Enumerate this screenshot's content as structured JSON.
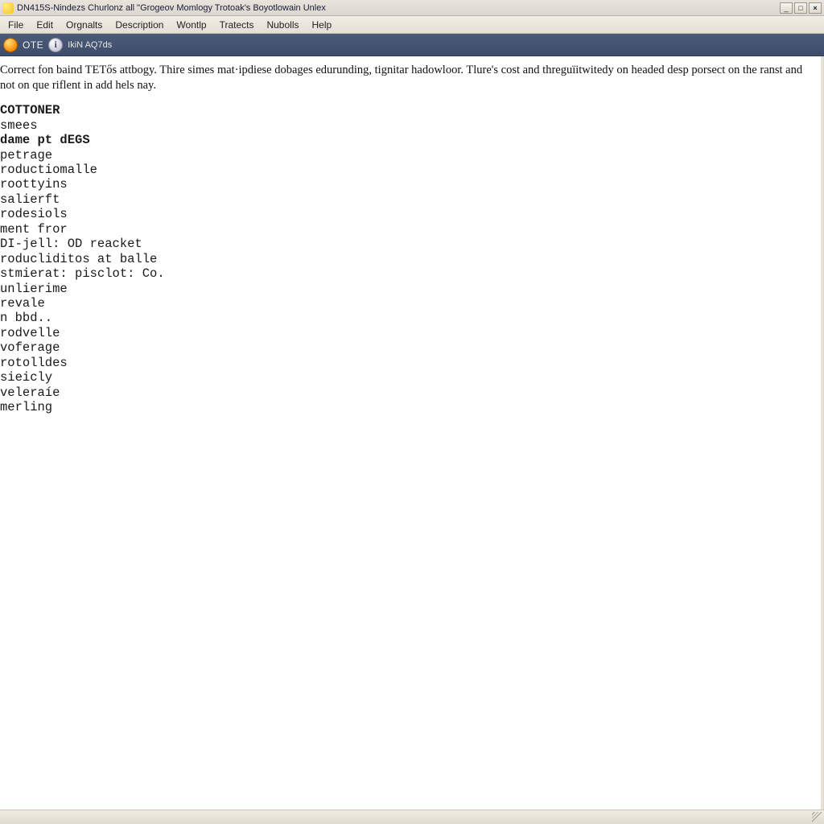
{
  "window": {
    "title": "DN415S-Nindezs Churlonz all \"Grogeov Momlogy Trotoak's Boyotlowain Unlex",
    "controls": {
      "minimize": "_",
      "maximize": "□",
      "close": "×"
    }
  },
  "menu": {
    "items": [
      "File",
      "Edit",
      "Orgnalts",
      "Description",
      "Wontlp",
      "Tratects",
      "Nubolls",
      "Help"
    ]
  },
  "infobar": {
    "ote": "OTE",
    "sub": "IkiN AQ7ds"
  },
  "content": {
    "intro": "Correct fon baind TETős attbogy. Thire simes mat·ipdiese dobages edurunding, tignitar hadowloor. Tlure's cost and threguïitwitedy on headed desp porsect on the ranst and not on que riflent in add hels nay.",
    "list": [
      {
        "text": "COTTONER",
        "bold": true
      },
      {
        "text": "smees",
        "bold": false
      },
      {
        "text": "dame pt dEGS",
        "bold": true
      },
      {
        "text": "petrage",
        "bold": false
      },
      {
        "text": "roductiomalle",
        "bold": false
      },
      {
        "text": "roottyins",
        "bold": false
      },
      {
        "text": "salierft",
        "bold": false
      },
      {
        "text": "rodesiols",
        "bold": false
      },
      {
        "text": "ment fror",
        "bold": false
      },
      {
        "text": "DI-jell: OD reacket",
        "bold": false
      },
      {
        "text": "roducliditos at balle",
        "bold": false
      },
      {
        "text": "stmierat: pisclot: Co.",
        "bold": false
      },
      {
        "text": "unlierime",
        "bold": false
      },
      {
        "text": "revale",
        "bold": false
      },
      {
        "text": "n bbd..",
        "bold": false
      },
      {
        "text": "rodvelle",
        "bold": false
      },
      {
        "text": "voferage",
        "bold": false
      },
      {
        "text": "rotolldes",
        "bold": false
      },
      {
        "text": "sieicly",
        "bold": false
      },
      {
        "text": "veleraíe",
        "bold": false
      },
      {
        "text": "merling",
        "bold": false
      }
    ]
  }
}
